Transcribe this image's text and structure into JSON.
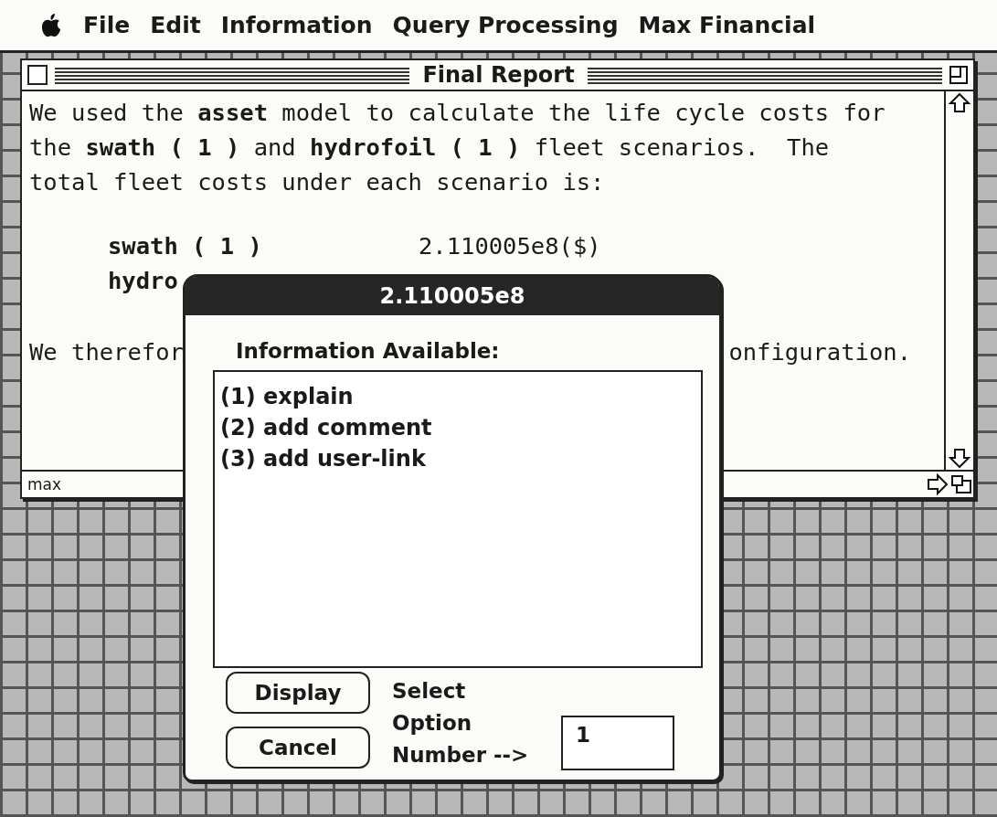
{
  "menu_bar": [
    "File",
    "Edit",
    "Information",
    "Query Processing",
    "Max Financial"
  ],
  "window": {
    "title": "Final Report",
    "status": "max",
    "paragraph": "We used the **asset** model to calculate the life cycle costs for the **swath ( 1 )** and **hydrofoil ( 1 )** fleet scenarios.  The total fleet costs under each scenario is:",
    "results": [
      {
        "label": "swath ( 1 )",
        "value": "2.110005e8($)"
      },
      {
        "label": "hydro"
      }
    ],
    "conclusion": {
      "left": "We therefor",
      "right": "onfiguration."
    }
  },
  "dialog": {
    "title": "2.110005e8",
    "heading": "Information Available:",
    "options": [
      "(1) explain",
      "(2) add comment",
      "(3) add user-link"
    ],
    "buttons": [
      "Display",
      "Cancel"
    ],
    "prompt": [
      "Select",
      "Option",
      "Number -->"
    ],
    "field_value": "1"
  }
}
